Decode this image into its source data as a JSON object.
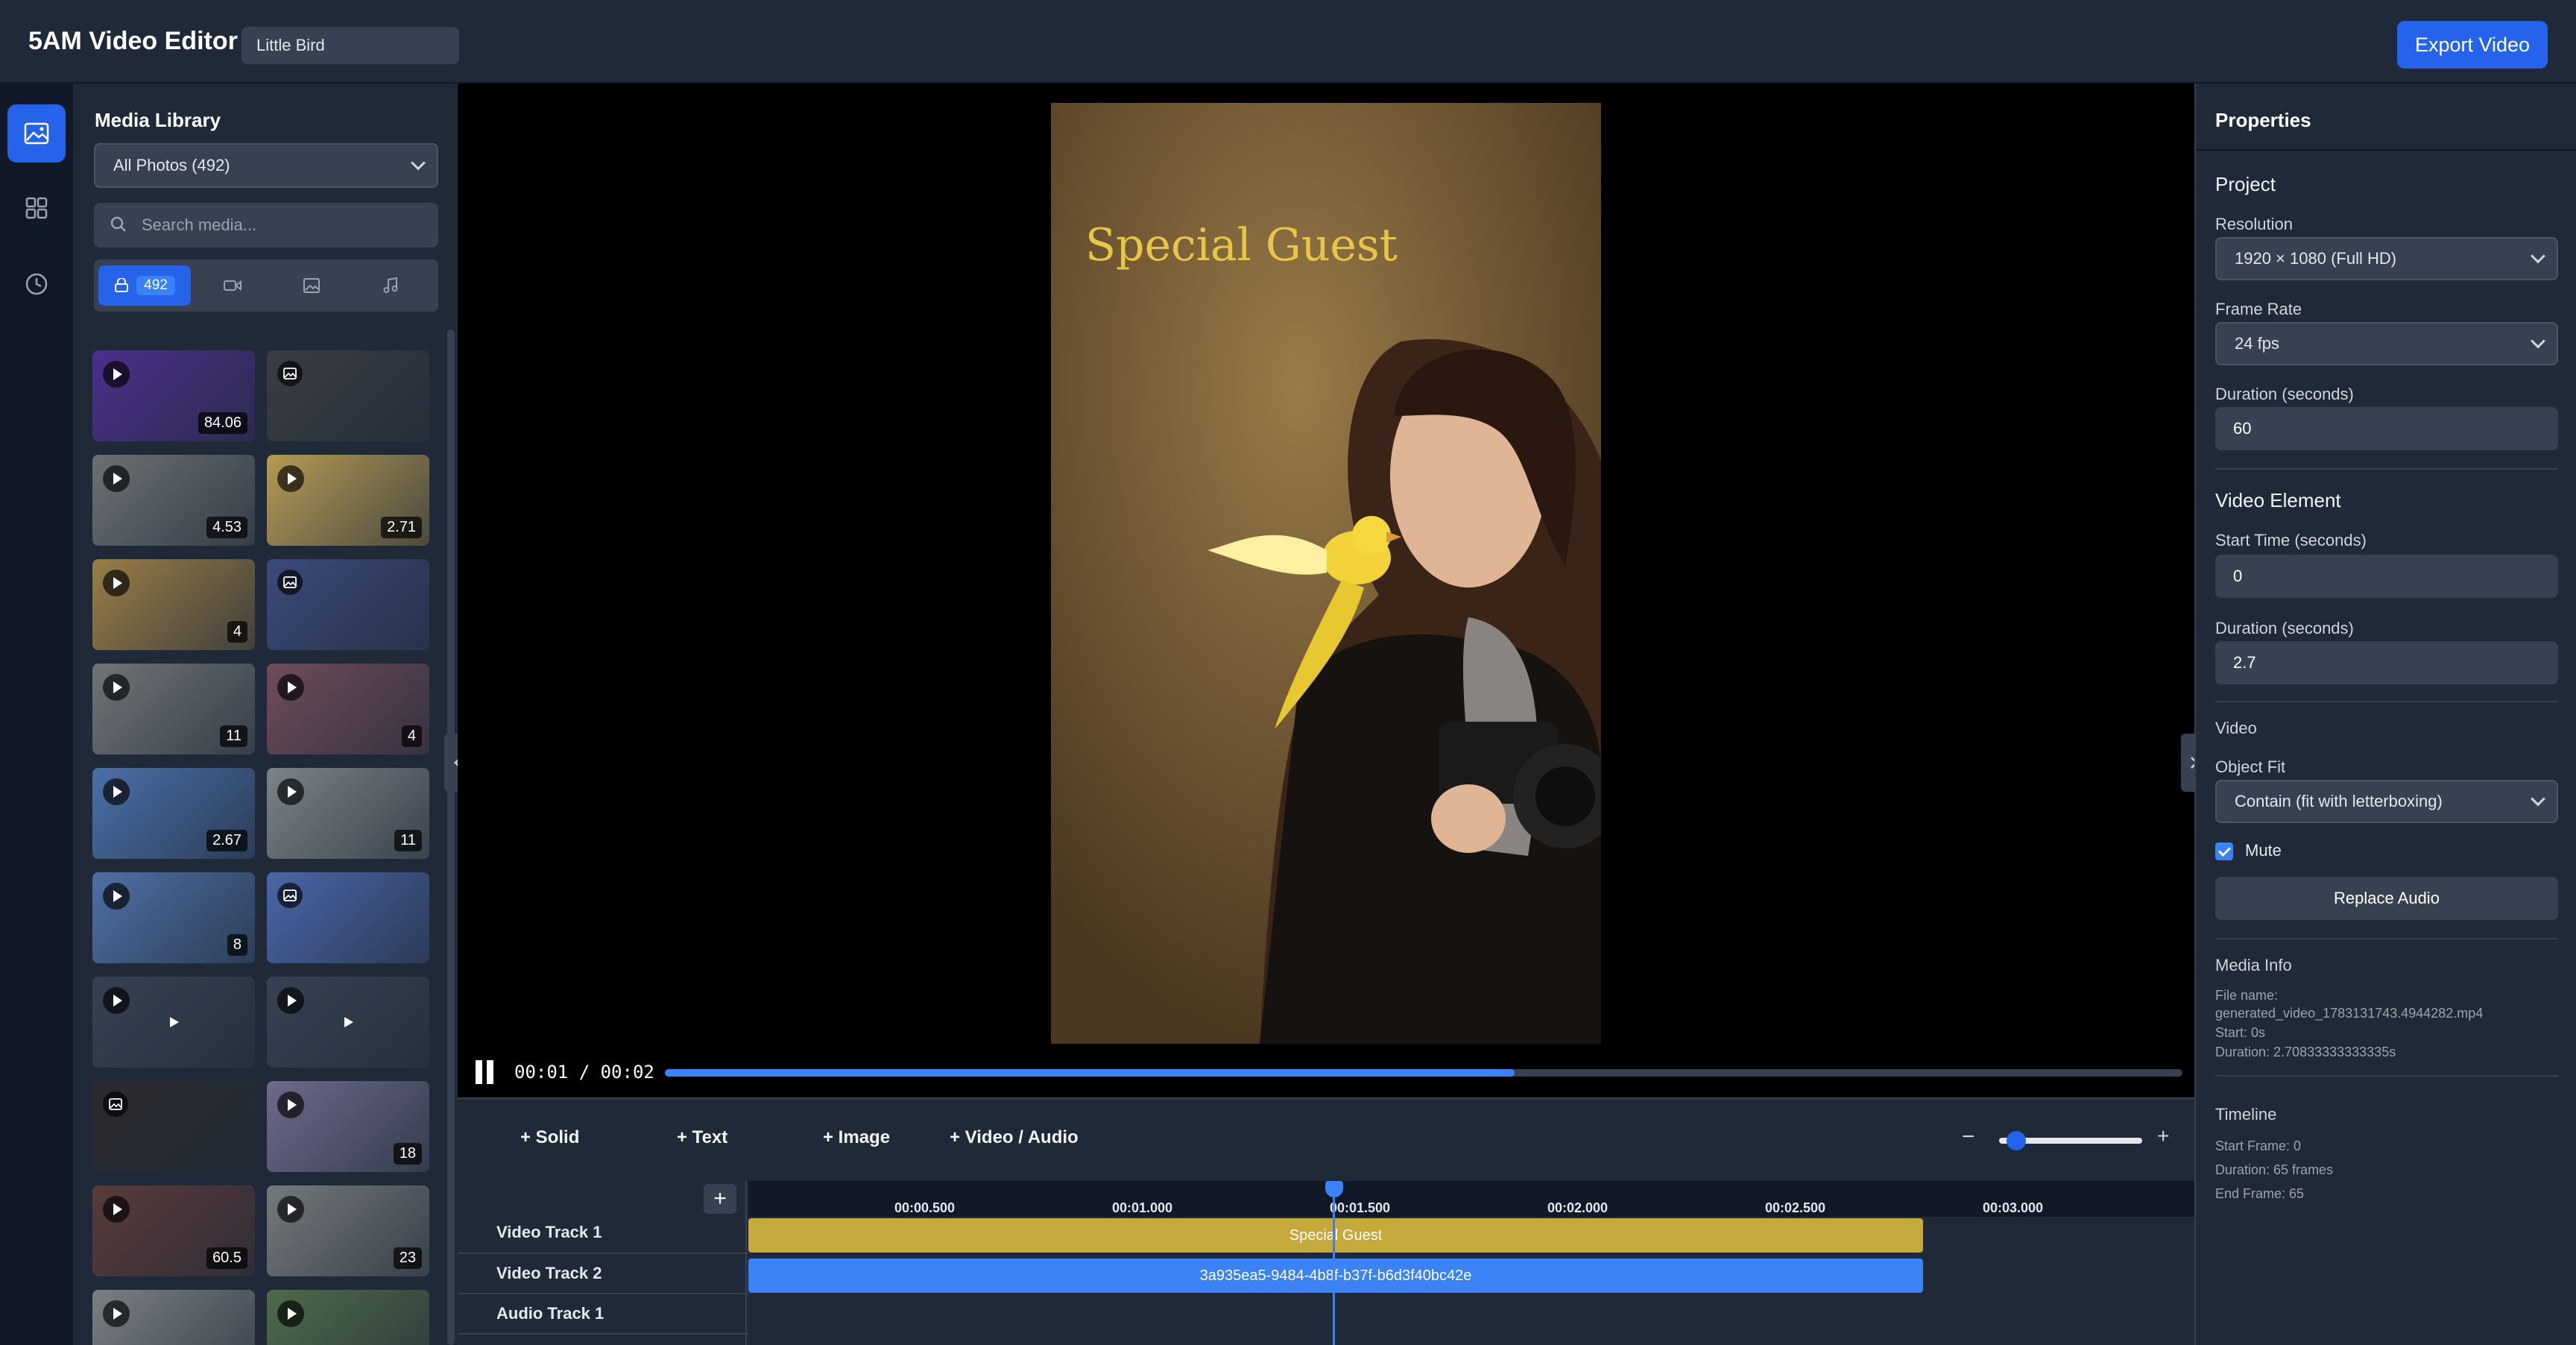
{
  "header": {
    "app_title": "5AM Video Editor",
    "project_name": "Little Bird",
    "export_label": "Export Video"
  },
  "rail": {
    "items": [
      "media-icon",
      "elements-icon",
      "history-icon"
    ]
  },
  "media": {
    "title": "Media Library",
    "filter_select": "All Photos (492)",
    "search_placeholder": "Search media...",
    "filter_count": "492",
    "thumbs": [
      {
        "type": "video",
        "duration": "84.06",
        "color": "#4c2f8a"
      },
      {
        "type": "image",
        "duration": "",
        "color": "#3a3d42"
      },
      {
        "type": "video",
        "duration": "4.53",
        "color": "#6b7072"
      },
      {
        "type": "video",
        "duration": "2.71",
        "color": "#b59a55"
      },
      {
        "type": "video",
        "duration": "4",
        "color": "#9a7d48"
      },
      {
        "type": "image",
        "duration": "",
        "color": "#3b4a7a"
      },
      {
        "type": "video",
        "duration": "11",
        "color": "#707476"
      },
      {
        "type": "video",
        "duration": "4",
        "color": "#6f4b5a"
      },
      {
        "type": "video",
        "duration": "2.67",
        "color": "#4a6fa8"
      },
      {
        "type": "video",
        "duration": "11",
        "color": "#7c8386"
      },
      {
        "type": "video",
        "duration": "8",
        "color": "#4e6fa5"
      },
      {
        "type": "image",
        "duration": "",
        "color": "#4a66a8"
      },
      {
        "type": "video",
        "duration": "",
        "color": "#374151"
      },
      {
        "type": "video",
        "duration": "",
        "color": "#374151"
      },
      {
        "type": "image",
        "duration": "",
        "color": "#2a2a2e"
      },
      {
        "type": "video",
        "duration": "18",
        "color": "#6d6a8a"
      },
      {
        "type": "video",
        "duration": "60.5",
        "color": "#5a3a3a"
      },
      {
        "type": "video",
        "duration": "23",
        "color": "#75797b"
      },
      {
        "type": "video",
        "duration": "",
        "color": "#7a7f82"
      },
      {
        "type": "video",
        "duration": "",
        "color": "#4e6a4a"
      }
    ]
  },
  "preview": {
    "overlay_text": "Special Guest",
    "timecode": "00:01 / 00:02",
    "progress": 0.56
  },
  "timeline_toolbar": {
    "add_solid": "+ Solid",
    "add_text": "+ Text",
    "add_image": "+ Image",
    "add_video_audio": "+ Video / Audio",
    "zoom_minus": "−",
    "zoom_plus": "+",
    "zoom_level": 0.05
  },
  "timeline": {
    "add_track": "+",
    "ruler": [
      "00:00.500",
      "00:01.000",
      "00:01.500",
      "00:02.000",
      "00:02.500",
      "00:03.000"
    ],
    "tracks": [
      "Video Track 1",
      "Video Track 2",
      "Audio Track 1"
    ],
    "clip_text": "Special Guest",
    "clip_video": "3a935ea5-9484-4b8f-b37f-b6d3f40bc42e",
    "playhead_time": "00:01.500"
  },
  "properties": {
    "title": "Properties",
    "project_section": "Project",
    "resolution_label": "Resolution",
    "resolution_value": "1920 × 1080 (Full HD)",
    "frame_rate_label": "Frame Rate",
    "frame_rate_value": "24 fps",
    "duration_label": "Duration (seconds)",
    "duration_value": "60",
    "video_element_section": "Video Element",
    "start_time_label": "Start Time (seconds)",
    "start_time_value": "0",
    "el_duration_label": "Duration (seconds)",
    "el_duration_value": "2.7",
    "video_section": "Video",
    "object_fit_label": "Object Fit",
    "object_fit_value": "Contain (fit with letterboxing)",
    "mute_label": "Mute",
    "replace_audio": "Replace Audio",
    "media_info_title": "Media Info",
    "file_name_label": "File name:",
    "file_name": "generated_video_1783131743.4944282.mp4",
    "start": "Start: 0s",
    "duration_info": "Duration: 2.70833333333335s",
    "timeline_title": "Timeline",
    "start_frame": "Start Frame: 0",
    "duration_frames": "Duration: 65 frames",
    "end_frame": "End Frame: 65"
  },
  "colors": {
    "accent": "#2563eb",
    "text_clip": "#c5a93a",
    "video_clip": "#3b82f6"
  }
}
